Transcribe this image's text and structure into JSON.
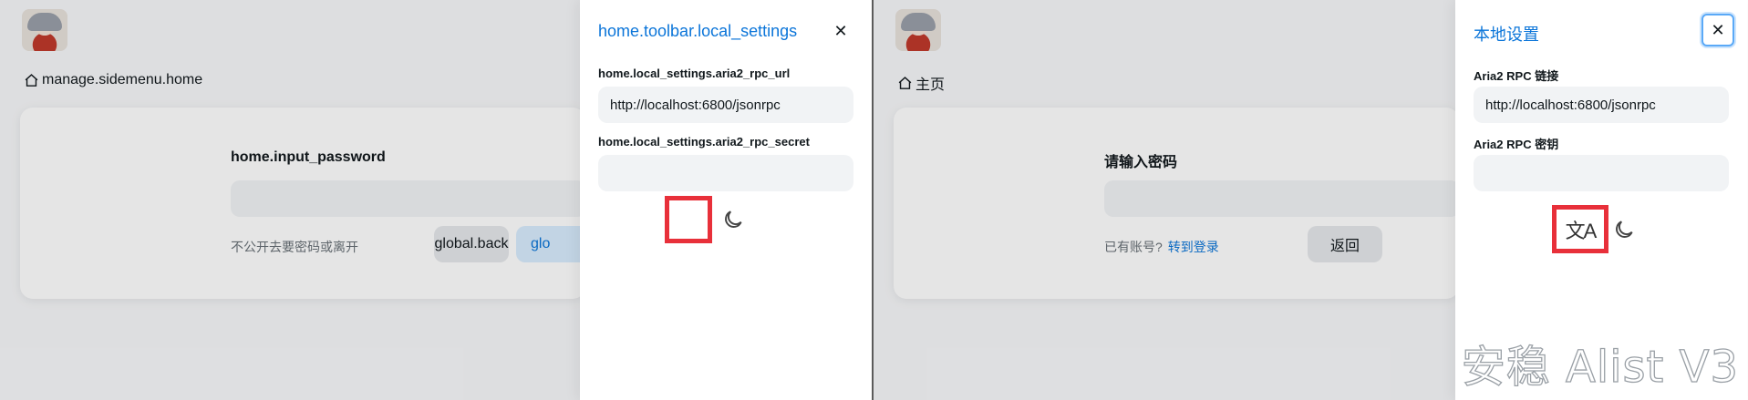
{
  "left_panel": {
    "breadcrumb": "manage.sidemenu.home",
    "card": {
      "title": "home.input_password",
      "hint": "不公开去要密码或离开",
      "hint_link": "",
      "back_label": "global.back",
      "confirm_label": "glo"
    },
    "drawer": {
      "title": "home.toolbar.local_settings",
      "close_symbol": "✕",
      "rpc_url_label": "home.local_settings.aria2_rpc_url",
      "rpc_url_value": "http://localhost:6800/jsonrpc",
      "rpc_secret_label": "home.local_settings.aria2_rpc_secret",
      "rpc_secret_value": "",
      "translate_icon": "",
      "moon_icon": "moon-icon"
    }
  },
  "right_panel": {
    "breadcrumb": "主页",
    "card": {
      "title": "请输入密码",
      "hint": "已有账号?",
      "hint_link": "转到登录",
      "back_label": "返回"
    },
    "drawer": {
      "title": "本地设置",
      "close_symbol": "✕",
      "rpc_url_label": "Aria2 RPC 链接",
      "rpc_url_value": "http://localhost:6800/jsonrpc",
      "rpc_secret_label": "Aria2 RPC 密钥",
      "rpc_secret_value": "",
      "translate_icon": "文A",
      "moon_icon": "moon-icon"
    },
    "watermark": "安稳 Alist V3"
  },
  "colors": {
    "accent": "#0b75d9",
    "highlight_box": "#e8303a",
    "field_bg": "#f1f3f5"
  }
}
